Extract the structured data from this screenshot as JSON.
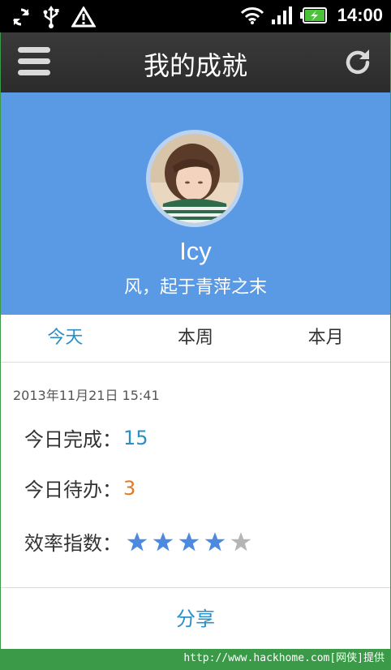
{
  "status_bar": {
    "time": "14:00",
    "icons": [
      "sync-icon",
      "usb-icon",
      "warning-icon",
      "wifi-icon",
      "signal-icon",
      "battery-charging-icon"
    ]
  },
  "app_bar": {
    "title": "我的成就",
    "left_icon": "menu-icon",
    "right_icon": "refresh-icon"
  },
  "profile": {
    "name": "Icy",
    "motto": "风，起于青萍之末"
  },
  "tabs": [
    {
      "label": "今天",
      "active": true
    },
    {
      "label": "本周",
      "active": false
    },
    {
      "label": "本月",
      "active": false
    }
  ],
  "stats": {
    "datetime": "2013年11月21日  15:41",
    "done_label": "今日完成：",
    "done_value": "15",
    "todo_label": "今日待办：",
    "todo_value": "3",
    "efficiency_label": "效率指数：",
    "efficiency_rating": 4,
    "efficiency_max": 5
  },
  "share_label": "分享",
  "footer_text": "http://www.hackhome.com[网侠]提供",
  "colors": {
    "accent_blue": "#2a8fc8",
    "header_blue": "#5a99e4",
    "todo_orange": "#e27a20",
    "star_filled": "#4a8be0",
    "star_empty": "#b5b5b5"
  }
}
